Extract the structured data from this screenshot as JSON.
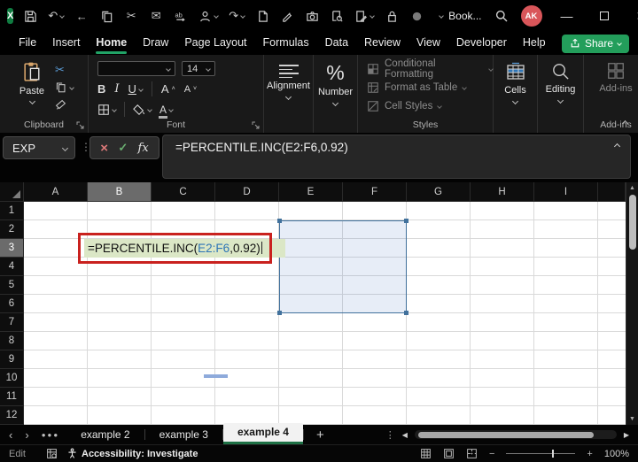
{
  "colors": {
    "accent_green": "#21a366",
    "share_green": "#239e5b",
    "tab_underline_green": "#1e7145",
    "selection_blue": "#41719c",
    "range_text_blue": "#2e75b6",
    "edit_fill_green": "#dbe7c6",
    "annotation_red": "#c9211e",
    "avatar_red": "#d9565a"
  },
  "titlebar": {
    "workbook_name": "Book...",
    "avatar_initials": "AK",
    "qat_icons": [
      "save-icon",
      "undo-icon",
      "back-icon",
      "copy-icon",
      "cut-icon",
      "mail-icon",
      "translate-icon",
      "account-icon",
      "redo-icon",
      "new-file-icon",
      "ink-pen-icon",
      "camera-icon",
      "book-search-icon",
      "edit-document-icon",
      "lock-search-icon",
      "record-icon",
      "more-icon"
    ]
  },
  "menu": {
    "items": [
      "File",
      "Insert",
      "Home",
      "Draw",
      "Page Layout",
      "Formulas",
      "Data",
      "Review",
      "View",
      "Developer",
      "Help"
    ],
    "active": "Home",
    "share_label": "Share"
  },
  "ribbon": {
    "paste_label": "Paste",
    "clipboard_group_label": "Clipboard",
    "font_size": "14",
    "bold_label": "B",
    "italic_label": "I",
    "underline_label": "U",
    "font_group_label": "Font",
    "alignment_label": "Alignment",
    "number_label": "Number",
    "number_icon": "%",
    "styles_items": [
      "Conditional Formatting",
      "Format as Table",
      "Cell Styles"
    ],
    "styles_group_label": "Styles",
    "cells_label": "Cells",
    "editing_label": "Editing",
    "addins_button_label": "Add-ins",
    "addins_group_label": "Add-ins"
  },
  "formula_bar": {
    "name_box_value": "EXP",
    "cancel_glyph": "×",
    "enter_glyph": "✓",
    "fx_label": "fx",
    "formula": "=PERCENTILE.INC(E2:F6,0.92)"
  },
  "grid": {
    "column_headers": [
      "A",
      "B",
      "C",
      "D",
      "E",
      "F",
      "G",
      "H",
      "I"
    ],
    "row_headers": [
      "1",
      "2",
      "3",
      "4",
      "5",
      "6",
      "7",
      "8",
      "9",
      "10",
      "11",
      "12"
    ],
    "selected_column": "B",
    "selected_row": "3",
    "edit_cell": {
      "cell": "B3",
      "formula_prefix": "=PERCENTILE.INC(",
      "formula_range": "E2:F6",
      "formula_suffix": ",0.92)"
    },
    "selected_range": "E2:F6"
  },
  "sheet_tabs": {
    "tabs": [
      "example 2",
      "example 3",
      "example 4"
    ],
    "active_tab": "example 4",
    "add_sheet_label": "+"
  },
  "status_bar": {
    "mode": "Edit",
    "accessibility_text": "Accessibility: Investigate",
    "zoom_level": "100%"
  }
}
